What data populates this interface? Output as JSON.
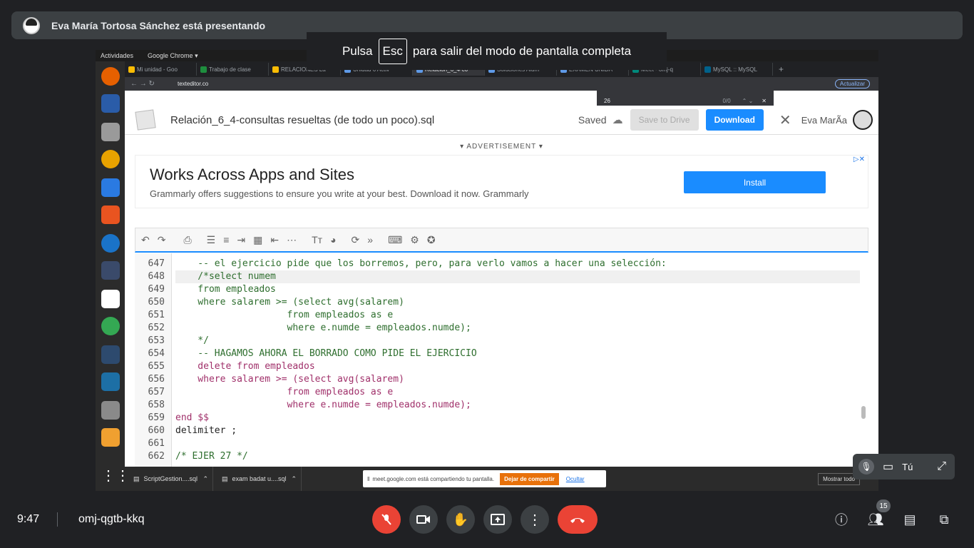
{
  "banner": {
    "presenter_text": "Eva María Tortosa Sánchez está presentando"
  },
  "fullscreen_hint": {
    "before": "Pulsa",
    "key": "Esc",
    "after": "para salir del modo de pantalla completa"
  },
  "gnome_bar": {
    "activities": "Actividades",
    "app": "Google Chrome ▾"
  },
  "browser": {
    "tabs": [
      "Mi unidad - Goo",
      "Trabajo de clase",
      "RELACIONES La",
      "Unidad 6 Activ",
      "Relación_6_4-co",
      "Soluciones Alum",
      "EXAMEN UNIDA",
      "Meet - omj-q",
      "MySQL :: MySQL"
    ],
    "url": "texteditor.co",
    "find_query": "26",
    "find_count": "0/0",
    "update_label": "Actualizar"
  },
  "app": {
    "filename": "Relación_6_4-consultas resueltas (de todo un poco).sql",
    "saved_label": "Saved",
    "save_drive_label": "Save to Drive",
    "download_label": "Download",
    "user_name": "Eva MarÃa"
  },
  "ad": {
    "label": "▾ ADVERTISEMENT ▾",
    "headline": "Works Across Apps and Sites",
    "subtext": "Grammarly offers suggestions to ensure you write at your best. Download it now. Grammarly",
    "cta": "Install"
  },
  "editor": {
    "line_numbers": [
      "647",
      "648",
      "649",
      "650",
      "651",
      "652",
      "653",
      "654",
      "655",
      "656",
      "657",
      "658",
      "659",
      "660",
      "661",
      "662"
    ],
    "lines": [
      "    -- el ejercicio pide que los borremos, pero, para verlo vamos a hacer una selección:",
      "    /*select numem",
      "    from empleados",
      "    where salarem >= (select avg(salarem)",
      "                    from empleados as e",
      "                    where e.numde = empleados.numde);",
      "    */",
      "    -- HAGAMOS AHORA EL BORRADO COMO PIDE EL EJERCICIO",
      "    delete from empleados",
      "    where salarem >= (select avg(salarem)",
      "                    from empleados as e",
      "                    where e.numde = empleados.numde);",
      "end $$",
      "delimiter ;",
      "",
      "/* EJER 27 */"
    ]
  },
  "taskbar": {
    "items": [
      "ScriptGestion....sql",
      "exam badat u....sql"
    ],
    "show_all": "Mostrar todo"
  },
  "meet_share_bar": {
    "text": "meet.google.com está compartiendo tu pantalla.",
    "stop": "Dejar de compartir",
    "hide": "Ocultar"
  },
  "self_tile": {
    "label": "Tú"
  },
  "meeting": {
    "time": "9:47",
    "code": "omj-qgtb-kkq",
    "participants": "15"
  }
}
